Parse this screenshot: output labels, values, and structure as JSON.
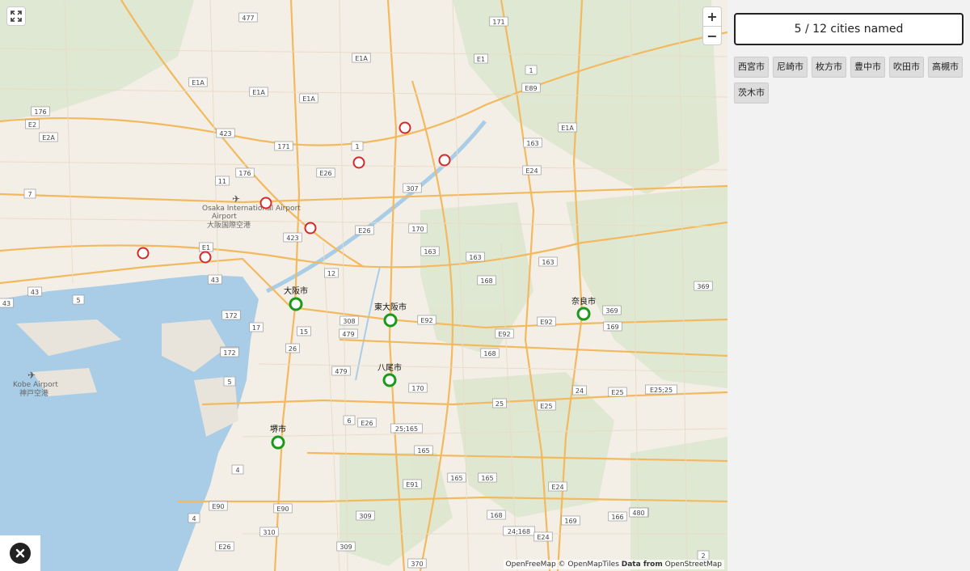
{
  "score": {
    "text": "5 / 12 cities named"
  },
  "answer_chips": [
    "西宮市",
    "尼崎市",
    "枚方市",
    "豊中市",
    "吹田市",
    "高槻市",
    "茨木市"
  ],
  "found_cities": [
    {
      "name": "大阪市"
    },
    {
      "name": "東大阪市"
    },
    {
      "name": "奈良市"
    },
    {
      "name": "八尾市"
    },
    {
      "name": "堺市"
    }
  ],
  "map_labels": {
    "airport_itami_en": "Osaka International Airport",
    "airport_itami_jp": "大阪国際空港",
    "airport_kobe_en": "Kobe Airport",
    "airport_kobe_jp": "神戸空港"
  },
  "road_shields": [
    "477",
    "171",
    "E1A",
    "E1",
    "1",
    "E89",
    "E1A",
    "E2A",
    "176",
    "E2",
    "7",
    "423",
    "11",
    "176",
    "E26",
    "171",
    "1",
    "307",
    "E24",
    "163",
    "423",
    "E26",
    "170",
    "163",
    "163",
    "163",
    "12",
    "168",
    "E92",
    "E92",
    "E92",
    "308",
    "479",
    "168",
    "172",
    "15",
    "26",
    "479",
    "E26",
    "6",
    "25;165",
    "165",
    "170",
    "25",
    "E25",
    "24",
    "E25",
    "E25;25",
    "166",
    "E91",
    "165",
    "165",
    "E24",
    "E90",
    "E90",
    "309",
    "168",
    "24;168",
    "E24",
    "169",
    "166",
    "480",
    "E26",
    "310",
    "309",
    "370",
    "2",
    "43",
    "43",
    "5",
    "17",
    "172",
    "172",
    "5",
    "4",
    "4",
    "369",
    "369",
    "169",
    "E1",
    "E1A",
    "E1A",
    "E1A",
    "43"
  ],
  "attribution": {
    "tiles": "OpenFreeMap © OpenMapTiles",
    "data_label": "Data from",
    "data_source": "OpenStreetMap"
  },
  "colors": {
    "found": "#1a9a1a",
    "unfound": "#d62828",
    "water": "#a9cde6",
    "land": "#f4efe6"
  }
}
